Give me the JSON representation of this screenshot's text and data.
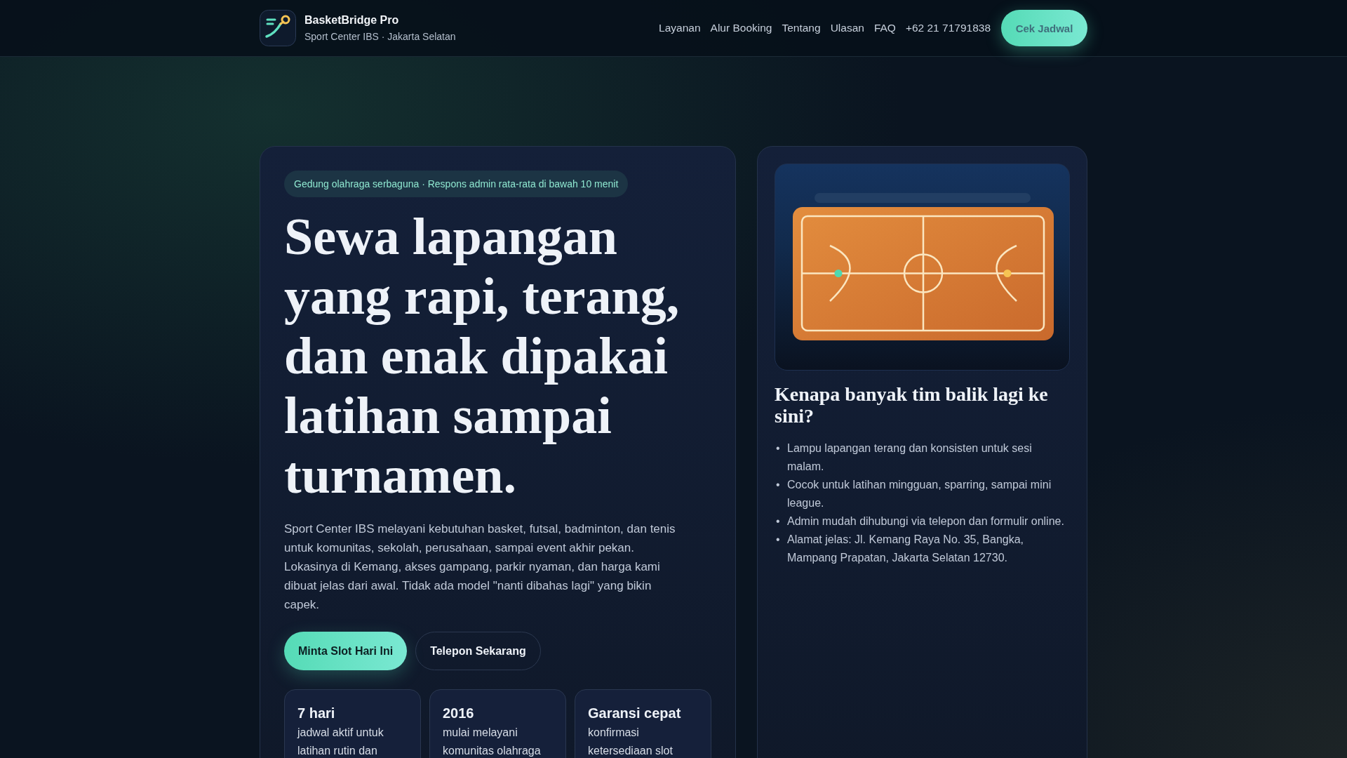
{
  "header": {
    "brand": {
      "name": "BasketBridge Pro",
      "tagline": "Sport Center IBS · Jakarta Selatan"
    },
    "nav": [
      "Layanan",
      "Alur Booking",
      "Tentang",
      "Ulasan",
      "FAQ",
      "+62 21 71791838"
    ],
    "cta": "Cek Jadwal"
  },
  "hero": {
    "badge": "Gedung olahraga serbaguna · Respons admin rata-rata di bawah 10 menit",
    "title": "Sewa lapangan yang rapi, terang, dan enak dipakai latihan sampai turnamen.",
    "description": "Sport Center IBS melayani kebutuhan basket, futsal, badminton, dan tenis untuk komunitas, sekolah, perusahaan, sampai event akhir pekan. Lokasinya di Kemang, akses gampang, parkir nyaman, dan harga kami dibuat jelas dari awal. Tidak ada model \"nanti dibahas lagi\" yang bikin capek.",
    "buttons": [
      {
        "label": "Minta Slot Hari Ini",
        "kind": "primary"
      },
      {
        "label": "Telepon Sekarang",
        "kind": "secondary"
      }
    ],
    "stats": [
      {
        "value": "7 hari",
        "text": "jadwal aktif untuk latihan rutin dan"
      },
      {
        "value": "2016",
        "text": "mulai melayani komunitas olahraga"
      },
      {
        "value": "Garansi cepat",
        "text": "konfirmasi ketersediaan slot"
      }
    ]
  },
  "aside": {
    "heading": "Kenapa banyak tim balik lagi ke sini?",
    "marker": "•",
    "points": [
      "Lampu lapangan terang dan konsisten untuk sesi malam.",
      "Cocok untuk latihan mingguan, sparring, sampai mini league.",
      "Admin mudah dihubungi via telepon dan formulir online.",
      "Alamat jelas: Jl. Kemang Raya No. 35, Bangka, Mampang Prapatan, Jakarta Selatan 12730."
    ]
  }
}
